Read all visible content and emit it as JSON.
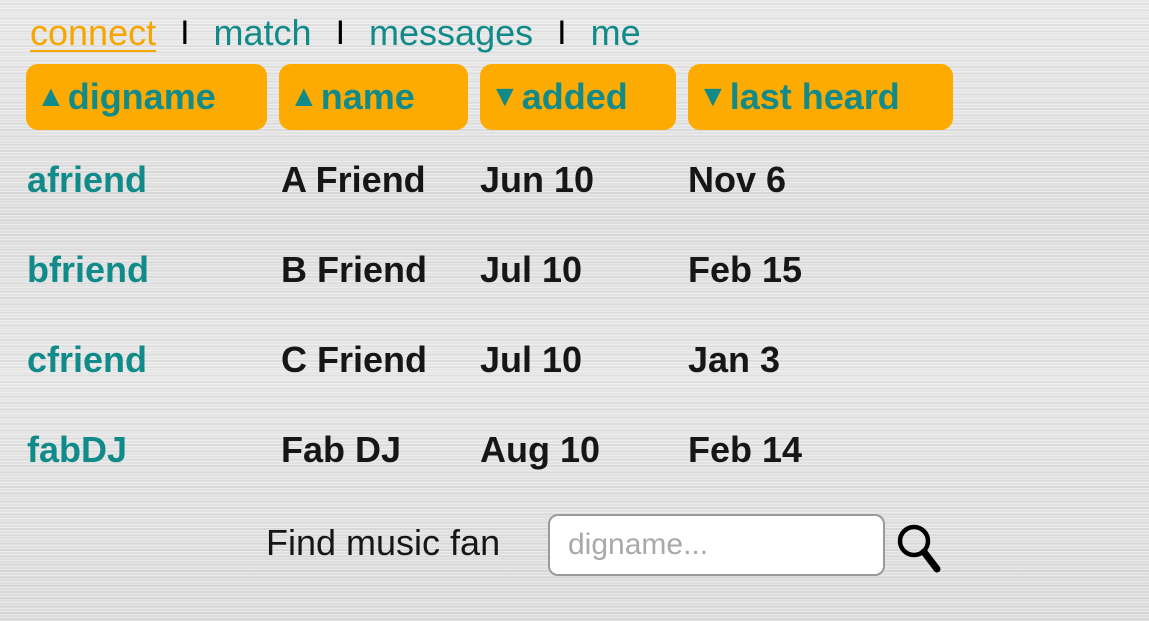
{
  "nav": {
    "items": [
      {
        "label": "connect",
        "active": true
      },
      {
        "label": "match",
        "active": false
      },
      {
        "label": "messages",
        "active": false
      },
      {
        "label": "me",
        "active": false
      }
    ],
    "separator": "I"
  },
  "table": {
    "columns": [
      {
        "label": "digname",
        "sort": "ascending",
        "arrow": "▲"
      },
      {
        "label": "name",
        "sort": "ascending",
        "arrow": "▲"
      },
      {
        "label": "added",
        "sort": "descending",
        "arrow": "▼"
      },
      {
        "label": "last heard",
        "sort": "descending",
        "arrow": "▼"
      }
    ],
    "rows": [
      [
        "afriend",
        "A Friend",
        "Jun 10",
        "Nov 6"
      ],
      [
        "bfriend",
        "B Friend",
        "Jul 10",
        "Feb 15"
      ],
      [
        "cfriend",
        "C Friend",
        "Jul 10",
        "Jan 3"
      ],
      [
        "fabDJ",
        "Fab DJ",
        "Aug 10",
        "Feb 14"
      ]
    ]
  },
  "search": {
    "label": "Find music fan",
    "placeholder": "digname...",
    "value": "",
    "icon": "magnifier-icon"
  },
  "colors": {
    "accent": "#fdab00",
    "link": "#118a8a",
    "active_nav": "#f7a600",
    "text": "#161616"
  }
}
